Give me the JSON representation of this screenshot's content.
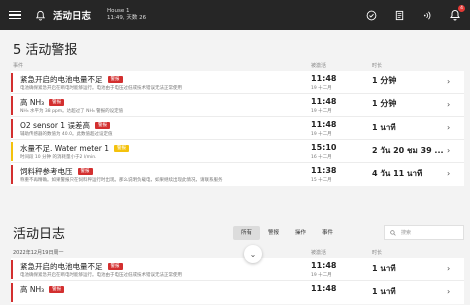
{
  "topbar": {
    "title": "活动日志",
    "house_name": "House 1",
    "house_sub": "11:49, 天数 26",
    "notification_count": "4"
  },
  "alerts": {
    "title": "5 活动警报",
    "col_event": "事件",
    "col_triggered": "被激活",
    "col_duration": "时长",
    "rows": [
      {
        "name": "紧急开启的电池电量不足",
        "tag": "警报",
        "desc": "电池确保紧急开启在断电时能够运行。电池由于电压过低或技术错误无法正常使用",
        "time": "11:48",
        "date": "19 十二月",
        "duration": "1 分钟",
        "color": "red"
      },
      {
        "name": "高 NH₃",
        "tag": "警报",
        "desc": "NH₃ 水平为 38 ppm。达超过了 NH₃ 警报的设定值",
        "time": "11:48",
        "date": "19 十二月",
        "duration": "1 分钟",
        "color": "red"
      },
      {
        "name": "O2 sensor 1 误差高",
        "tag": "警报",
        "desc": "辅助传感器的数值为 40.0。此数值超过设定值",
        "time": "11:48",
        "date": "19 十二月",
        "duration": "1 นาที",
        "color": "red"
      },
      {
        "name": "水量不足. Water meter 1",
        "tag": "警报",
        "desc": "时间段 10 分钟 的消耗量小于2 l/min.",
        "time": "15:10",
        "date": "16 十二月",
        "duration": "2 วัน 20 ชม 39 ...",
        "color": "yellow"
      },
      {
        "name": "饲料秤参考电压",
        "tag": "警报",
        "desc": "称重不再精确。如果警报只在饲料秤运行时出现。那么说明负载电，如果继续出现此情况，请联系服务",
        "time": "11:38",
        "date": "15 十二月",
        "duration": "4 วัน 11 นาที",
        "color": "red"
      }
    ]
  },
  "log": {
    "title": "活动日志",
    "filters": [
      "所有",
      "警报",
      "操作",
      "事件"
    ],
    "active_filter": "所有",
    "search_placeholder": "搜索",
    "date_group": "2022年12月19日周一",
    "col_triggered": "被激活",
    "col_duration": "时长",
    "rows": [
      {
        "name": "紧急开启的电池电量不足",
        "tag": "警报",
        "desc": "电池确保紧急开启在断电时能够运行。电池由于电压过低或技术错误无法正常使用",
        "time": "11:48",
        "date": "19 十二月",
        "duration": "1 นาที",
        "color": "red"
      },
      {
        "name": "高 NH₃",
        "tag": "警报",
        "desc": "",
        "time": "11:48",
        "date": "",
        "duration": "1 นาที",
        "color": "red"
      }
    ]
  },
  "colors": {
    "alarm": "#d32f2f",
    "warning": "#f4c20d",
    "topbar": "#262626"
  }
}
